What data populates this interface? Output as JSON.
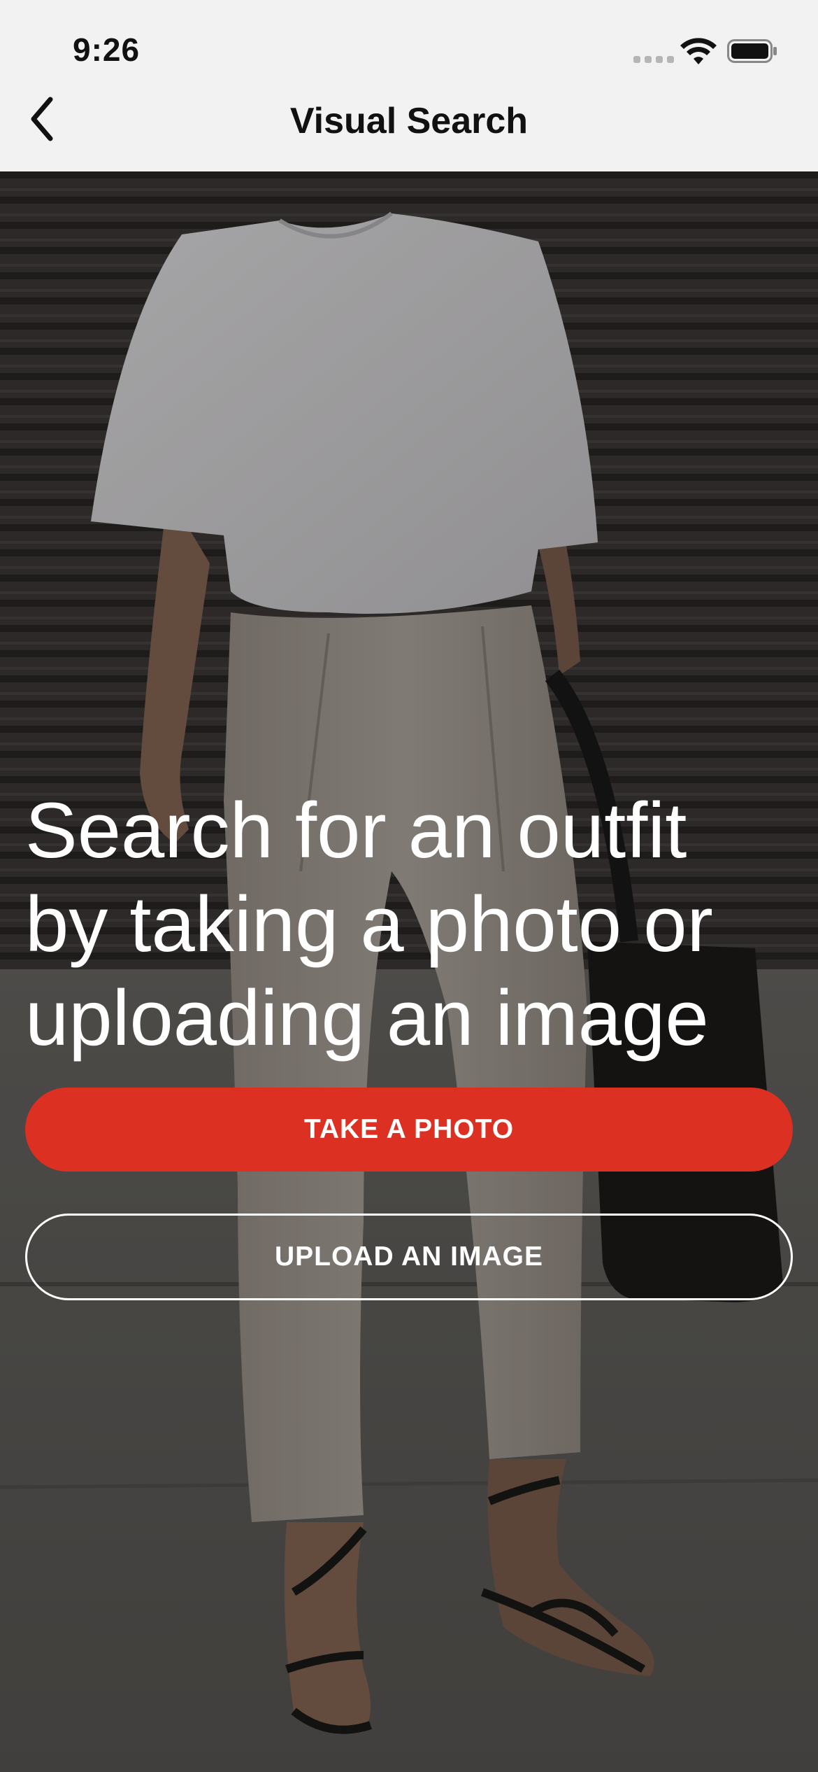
{
  "status_bar": {
    "time": "9:26"
  },
  "nav": {
    "title": "Visual Search",
    "back_icon": "chevron-left-icon"
  },
  "hero": {
    "headline_lines": [
      "Search for an outfit",
      "by taking a photo or",
      "uploading an image"
    ]
  },
  "actions": {
    "take_photo_label": "TAKE A PHOTO",
    "upload_image_label": "UPLOAD AN IMAGE"
  },
  "colors": {
    "accent": "#dc3023",
    "nav_bg": "#f2f2f2",
    "text_light": "#ffffff"
  }
}
